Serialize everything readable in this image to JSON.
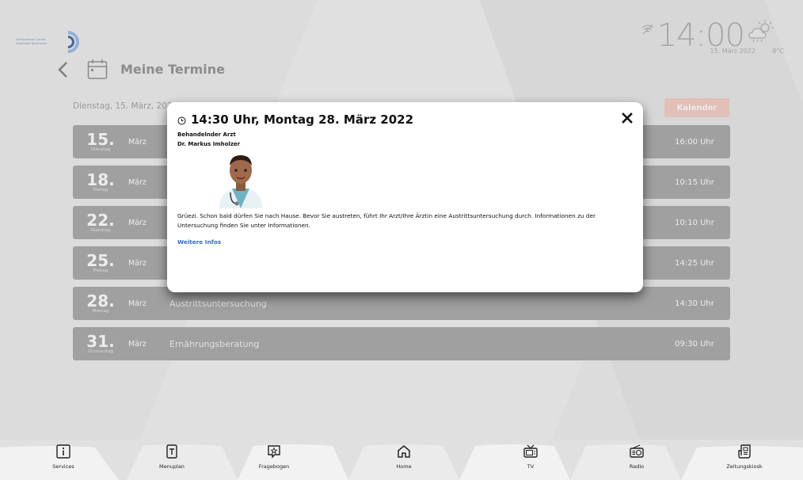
{
  "logo": {
    "text": "Spitalzentrum Centre hospitalier Biel-Bienne"
  },
  "header": {
    "time": "14:00",
    "date": "15. März 2022",
    "temperature": "8°C",
    "page_title": "Meine Termine"
  },
  "date_header": "Dienstag, 15. März, 202",
  "kalender_label": "Kalender",
  "appointments": [
    {
      "day": "15.",
      "weekday": "Dienstag",
      "month": "März",
      "title": "",
      "time": "16:00 Uhr"
    },
    {
      "day": "18.",
      "weekday": "Freitag",
      "month": "März",
      "title": "",
      "time": "10:15 Uhr"
    },
    {
      "day": "22.",
      "weekday": "Dienstag",
      "month": "März",
      "title": "",
      "time": "10:10 Uhr"
    },
    {
      "day": "25.",
      "weekday": "Freitag",
      "month": "März",
      "title": "",
      "time": "14:25 Uhr"
    },
    {
      "day": "28.",
      "weekday": "Montag",
      "month": "März",
      "title": "Austrittsuntersuchung",
      "time": "14:30 Uhr"
    },
    {
      "day": "31.",
      "weekday": "Donnerstag",
      "month": "März",
      "title": "Ernährungsberatung",
      "time": "09:30 Uhr"
    }
  ],
  "modal": {
    "title": "14:30 Uhr, Montag 28. März 2022",
    "doctor_role": "Behandelnder Arzt",
    "doctor_name": "Dr. Markus Imholzer",
    "message": "Grüezi. Schon bald dürfen Sie nach Hause. Bevor Sie austreten, führt Ihr Arzt/Ihre Ärztin eine Austrittsuntersuchung durch. Informationen zu der Untersuchung finden Sie unter Informationen.",
    "more_link": "Weitere Infos"
  },
  "nav": [
    {
      "label": "Services",
      "icon": "info-icon"
    },
    {
      "label": "Menuplan",
      "icon": "menu-card-icon"
    },
    {
      "label": "Fragebogen",
      "icon": "questionnaire-icon"
    },
    {
      "label": "Home",
      "icon": "home-icon"
    },
    {
      "label": "TV",
      "icon": "tv-icon"
    },
    {
      "label": "Radio",
      "icon": "radio-icon"
    },
    {
      "label": "Zeitungskiosk",
      "icon": "newspaper-icon"
    }
  ],
  "colors": {
    "row_bg": "#a3a3a3",
    "kalender_bg": "#f3c9bf",
    "link": "#2d6bd6",
    "nav_bg": "#e0e0e0"
  }
}
